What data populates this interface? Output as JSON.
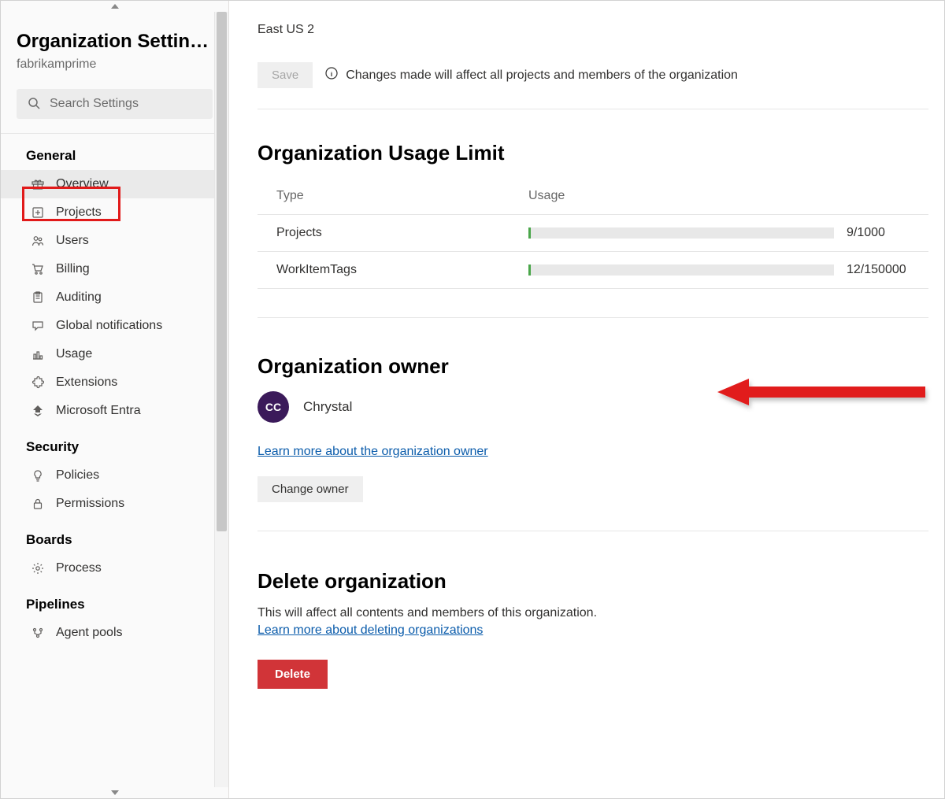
{
  "sidebar": {
    "title": "Organization Settin…",
    "subtitle": "fabrikamprime",
    "search_placeholder": "Search Settings",
    "groups": [
      {
        "title": "General",
        "items": [
          {
            "icon": "gift",
            "label": "Overview",
            "selected": true
          },
          {
            "icon": "plus-box",
            "label": "Projects"
          },
          {
            "icon": "people",
            "label": "Users"
          },
          {
            "icon": "cart",
            "label": "Billing"
          },
          {
            "icon": "clipboard",
            "label": "Auditing"
          },
          {
            "icon": "speech",
            "label": "Global notifications"
          },
          {
            "icon": "chart",
            "label": "Usage"
          },
          {
            "icon": "puzzle",
            "label": "Extensions"
          },
          {
            "icon": "entra",
            "label": "Microsoft Entra"
          }
        ]
      },
      {
        "title": "Security",
        "items": [
          {
            "icon": "bulb",
            "label": "Policies"
          },
          {
            "icon": "lock",
            "label": "Permissions"
          }
        ]
      },
      {
        "title": "Boards",
        "items": [
          {
            "icon": "gear",
            "label": "Process"
          }
        ]
      },
      {
        "title": "Pipelines",
        "items": [
          {
            "icon": "pools",
            "label": "Agent pools"
          }
        ]
      }
    ]
  },
  "main": {
    "region_value": "East US 2",
    "save_label": "Save",
    "save_info": "Changes made will affect all projects and members of the organization",
    "usage": {
      "heading": "Organization Usage Limit",
      "col_type": "Type",
      "col_usage": "Usage",
      "rows": [
        {
          "name": "Projects",
          "used": 9,
          "limit": 1000,
          "display": "9/1000"
        },
        {
          "name": "WorkItemTags",
          "used": 12,
          "limit": 150000,
          "display": "12/150000"
        }
      ]
    },
    "owner": {
      "heading": "Organization owner",
      "initials": "CC",
      "name": "Chrystal",
      "learn_more": "Learn more about the organization owner",
      "change_label": "Change owner"
    },
    "deleteOrg": {
      "heading": "Delete organization",
      "desc": "This will affect all contents and members of this organization.",
      "learn_more": "Learn more about deleting organizations",
      "button": "Delete"
    }
  },
  "colors": {
    "danger": "#d13438",
    "link": "#0b5cab",
    "bar_fill": "#4aa64a",
    "avatar": "#3b1a5a",
    "annotation": "#e11a1a"
  }
}
